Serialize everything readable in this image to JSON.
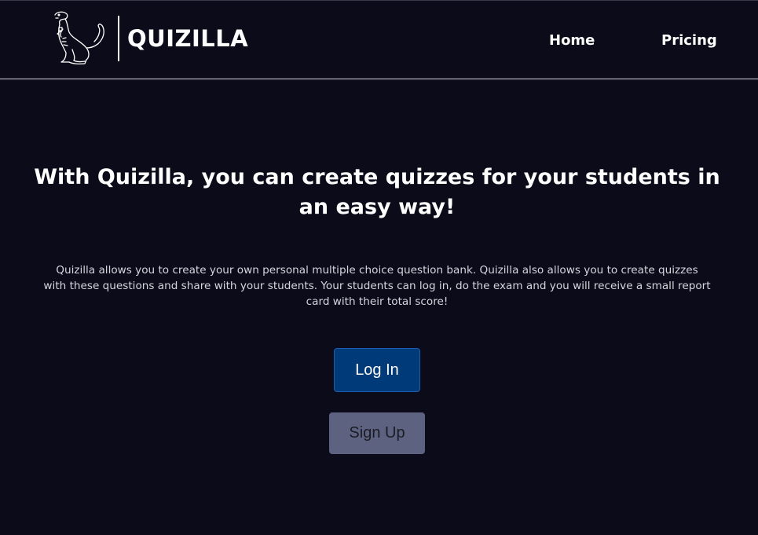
{
  "header": {
    "brand_name": "QUIZILLA",
    "logo_icon": "dinosaur-icon",
    "nav": [
      {
        "label": "Home"
      },
      {
        "label": "Pricing"
      }
    ]
  },
  "hero": {
    "title": "With Quizilla, you can create quizzes for your students in an easy way!",
    "description": "Quizilla allows you to create your own personal multiple choice question bank. Quizilla also allows you to create quizzes with these questions and share with your students. Your students can log in, do the exam and you will receive a small report card with their total score!"
  },
  "actions": {
    "login_label": "Log In",
    "signup_label": "Sign Up"
  },
  "colors": {
    "background": "#0b0b1a",
    "login_button": "#003a78",
    "signup_button": "#5c6280",
    "text": "#ffffff"
  }
}
